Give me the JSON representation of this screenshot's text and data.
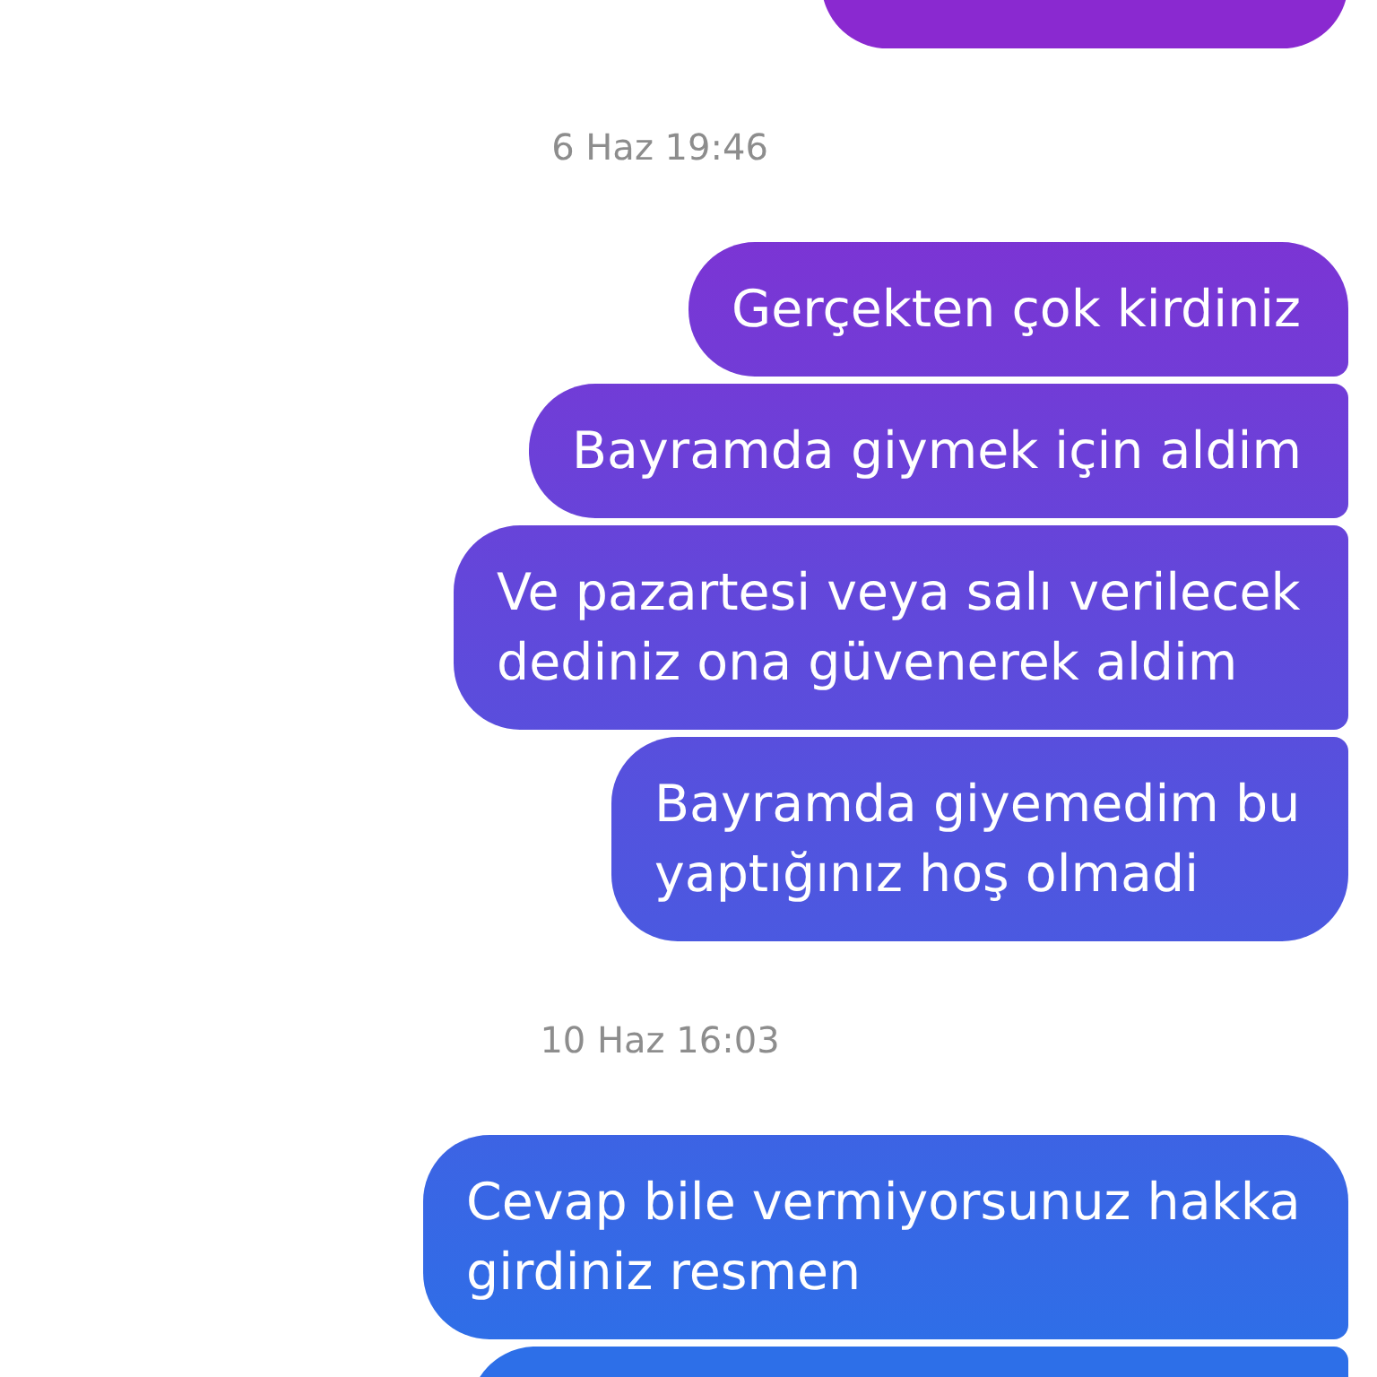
{
  "conversation": {
    "items": [
      {
        "kind": "message_cut_top"
      },
      {
        "kind": "timestamp",
        "text": "6 Haz 19:46"
      },
      {
        "kind": "message",
        "text": "Gerçekten çok kirdiniz"
      },
      {
        "kind": "message",
        "text": "Bayramda giymek için aldim"
      },
      {
        "kind": "message",
        "text": "Ve pazartesi veya salı verilecek dediniz ona güvenerek aldim"
      },
      {
        "kind": "message",
        "text": "Bayramda giyemedim bu yaptığınız hoş olmadi"
      },
      {
        "kind": "timestamp",
        "text": "10 Haz 16:03"
      },
      {
        "kind": "message",
        "text": "Cevap bile vermiyorsunuz hakka girdiniz resmen"
      },
      {
        "kind": "message_cut_bottom"
      }
    ]
  }
}
